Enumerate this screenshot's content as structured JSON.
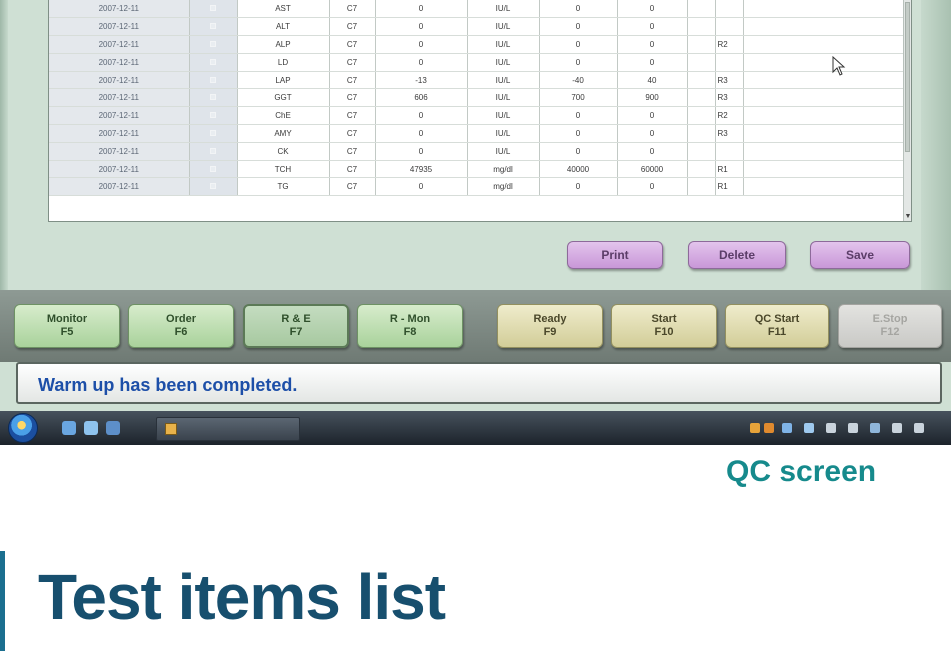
{
  "table": {
    "rows": [
      [
        "2007-12-11",
        "AST",
        "C7",
        "0",
        "IU/L",
        "0",
        "0",
        ""
      ],
      [
        "2007-12-11",
        "ALT",
        "C7",
        "0",
        "IU/L",
        "0",
        "0",
        ""
      ],
      [
        "2007-12-11",
        "ALP",
        "C7",
        "0",
        "IU/L",
        "0",
        "0",
        "R2"
      ],
      [
        "2007-12-11",
        "LD",
        "C7",
        "0",
        "IU/L",
        "0",
        "0",
        ""
      ],
      [
        "2007-12-11",
        "LAP",
        "C7",
        "-13",
        "IU/L",
        "-40",
        "40",
        "R3"
      ],
      [
        "2007-12-11",
        "GGT",
        "C7",
        "606",
        "IU/L",
        "700",
        "900",
        "R3"
      ],
      [
        "2007-12-11",
        "ChE",
        "C7",
        "0",
        "IU/L",
        "0",
        "0",
        "R2"
      ],
      [
        "2007-12-11",
        "AMY",
        "C7",
        "0",
        "IU/L",
        "0",
        "0",
        "R3"
      ],
      [
        "2007-12-11",
        "CK",
        "C7",
        "0",
        "IU/L",
        "0",
        "0",
        ""
      ],
      [
        "2007-12-11",
        "TCH",
        "C7",
        "47935",
        "mg/dl",
        "40000",
        "60000",
        "R1"
      ],
      [
        "2007-12-11",
        "TG",
        "C7",
        "0",
        "mg/dl",
        "0",
        "0",
        "R1"
      ]
    ]
  },
  "actions": {
    "print": "Print",
    "delete": "Delete",
    "save": "Save"
  },
  "fkeys": [
    {
      "label": "Monitor",
      "key": "F5"
    },
    {
      "label": "Order",
      "key": "F6"
    },
    {
      "label": "R & E",
      "key": "F7"
    },
    {
      "label": "R - Mon",
      "key": "F8"
    },
    {
      "label": "Ready",
      "key": "F9"
    },
    {
      "label": "Start",
      "key": "F10"
    },
    {
      "label": "QC Start",
      "key": "F11"
    },
    {
      "label": "E.Stop",
      "key": "F12"
    }
  ],
  "status": {
    "message": "Warm up has been completed."
  },
  "icons": {
    "start": "windows-start-icon",
    "cursor": "mouse-pointer-icon",
    "task": "application-task-icon"
  },
  "colors": {
    "background": "#cfe0d4",
    "status_text": "#1d4fa8",
    "action_button": "#d7aee4",
    "fkey_green": "#b8dbab",
    "fkey_yellow": "#e2deb0",
    "caption": "#168a8c",
    "title": "#174f6e"
  },
  "brochure": {
    "caption": "QC screen",
    "title": "Test items list"
  }
}
